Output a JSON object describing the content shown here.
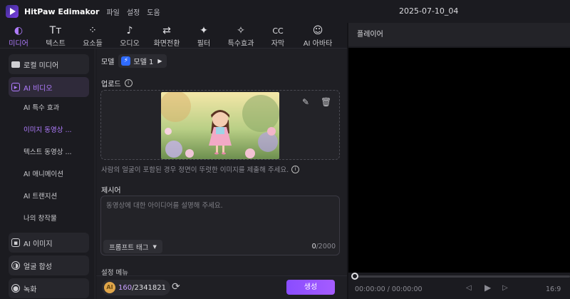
{
  "app": {
    "title": "HitPaw Edimakor",
    "menus": [
      "파일",
      "설정",
      "도움"
    ],
    "project_title": "2025-07-10_04"
  },
  "tabs": [
    {
      "label": "미디어",
      "icon": "media-icon",
      "glyph": "◐",
      "active": true
    },
    {
      "label": "텍스트",
      "icon": "text-icon",
      "glyph": "Tт",
      "active": false
    },
    {
      "label": "요소들",
      "icon": "elements-icon",
      "glyph": "⁘",
      "active": false
    },
    {
      "label": "오디오",
      "icon": "audio-icon",
      "glyph": "♪",
      "active": false
    },
    {
      "label": "화면전환",
      "icon": "transition-icon",
      "glyph": "⇄",
      "active": false
    },
    {
      "label": "필터",
      "icon": "filter-icon",
      "glyph": "✦",
      "active": false
    },
    {
      "label": "특수효과",
      "icon": "effects-icon",
      "glyph": "✧",
      "active": false
    },
    {
      "label": "자막",
      "icon": "subtitle-icon",
      "glyph": "CC",
      "active": false
    },
    {
      "label": "AI 아바타",
      "icon": "avatar-icon",
      "glyph": "☺",
      "active": false
    }
  ],
  "sidebar": {
    "local_media": "로컬 미디어",
    "ai_video": "AI 비디오",
    "ai_video_sub": [
      {
        "label": "AI 특수 효과",
        "active": false
      },
      {
        "label": "이미지 동영상 ...",
        "active": true
      },
      {
        "label": "텍스트 동영상 ...",
        "active": false
      },
      {
        "label": "AI 애니메이션",
        "active": false
      },
      {
        "label": "AI 트랜지션",
        "active": false
      },
      {
        "label": "나의 창작물",
        "active": false
      }
    ],
    "ai_image": "AI 이미지",
    "face_swap": "얼굴 합성",
    "record": "녹화"
  },
  "panel": {
    "model_label": "모델",
    "model_value": "모델 1",
    "upload_label": "업로드",
    "upload_hint": "사람의 얼굴이 포함된 경우 정면이 뚜렷한 이미지를 제출해 주세요.",
    "prompt_label": "제시어",
    "prompt_placeholder": "동영상에 대한 아이디어를 설명해 주세요.",
    "prompt_tag_button": "프롬프트 태그",
    "char_count": "0",
    "char_max": "/2000",
    "settings_label": "설정 메뉴",
    "credits_used": "160",
    "credits_total": "/2341821",
    "generate_button": "생성"
  },
  "player": {
    "title": "플레이어",
    "timecode": "00:00:00 / 00:00:00",
    "ratio": "16:9"
  },
  "colors": {
    "accent": "#8a4dff",
    "accent_text": "#b07cff",
    "background": "#141418",
    "panel": "#1f1f24"
  }
}
